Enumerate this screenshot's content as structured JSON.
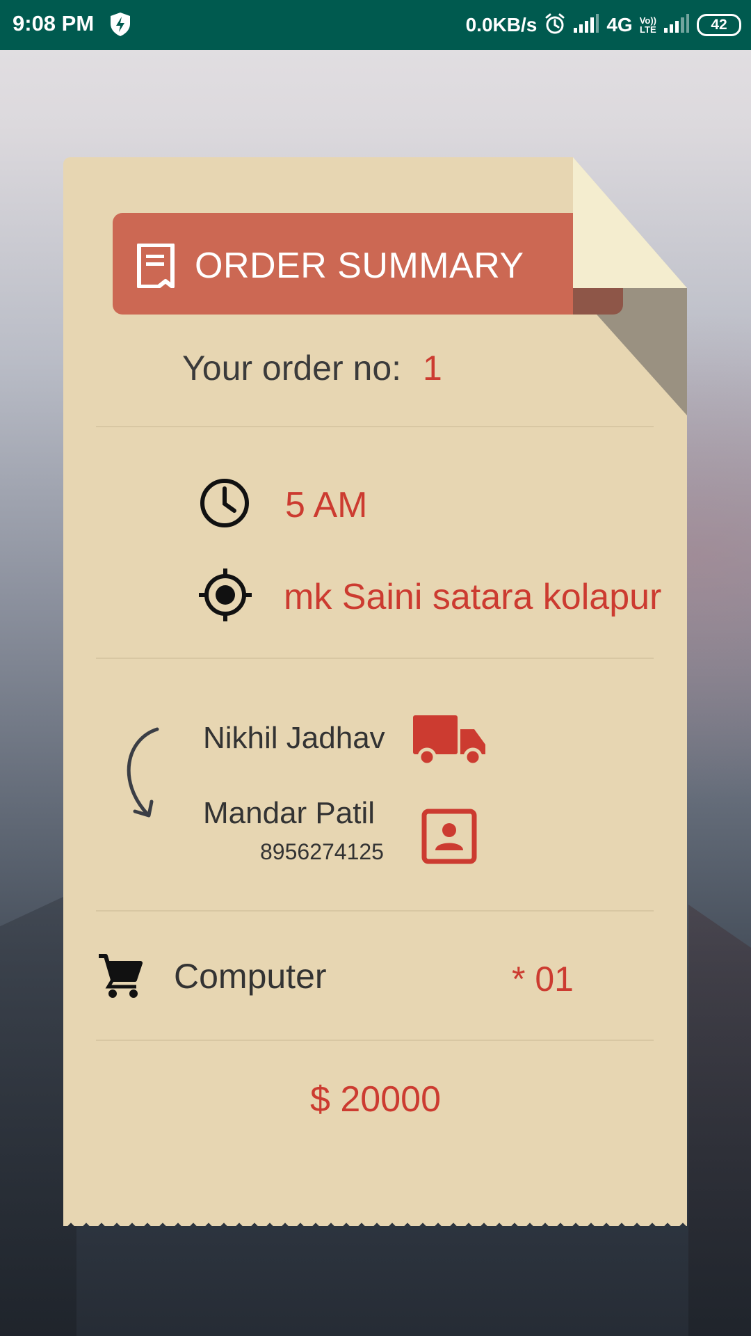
{
  "status_bar": {
    "time": "9:08 PM",
    "speed": "0.0KB/s",
    "network": "4G",
    "volte_line1": "Vo))",
    "volte_line2": "LTE",
    "battery": "42"
  },
  "receipt": {
    "title": "ORDER SUMMARY",
    "order_label": "Your order no:",
    "order_number": "1",
    "time": "5 AM",
    "address": "mk Saini satara kolapur",
    "from_name": "Nikhil Jadhav",
    "to_name": "Mandar Patil",
    "to_phone": "8956274125",
    "item_name": "Computer",
    "item_quantity": "* 01",
    "total": "$ 20000"
  },
  "colors": {
    "status_bar": "#005a4f",
    "paper": "#e7d6b2",
    "banner": "#cc6853",
    "accent_red": "#cc3b30"
  },
  "icons": {
    "status": [
      "shield-bolt-icon",
      "alarm-icon",
      "signal-icon",
      "battery-icon"
    ],
    "receipt": [
      "receipt-icon",
      "clock-icon",
      "location-target-icon",
      "curved-arrow-icon",
      "truck-icon",
      "contact-card-icon",
      "cart-icon"
    ]
  }
}
